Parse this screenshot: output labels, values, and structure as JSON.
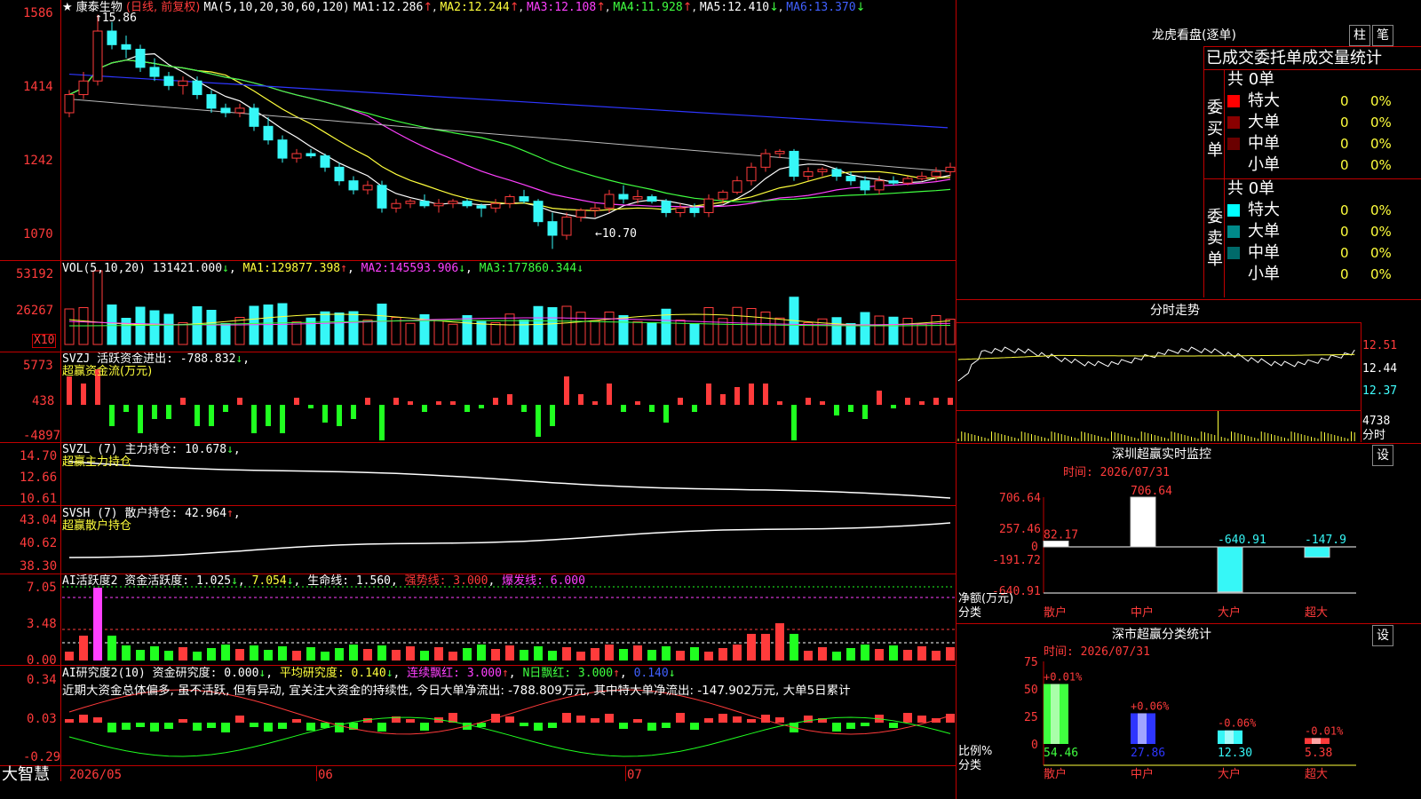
{
  "colors": {
    "up": "#ff3b3b",
    "down": "#36f7f7",
    "frame": "#c00000",
    "ma1": "#ffffff",
    "ma2": "#ffff3c",
    "ma3": "#ff40ff",
    "ma4": "#40ff40",
    "ma5": "#bbbbbb",
    "ma6": "#2e36ff"
  },
  "app": {
    "brand": "大智慧"
  },
  "main": {
    "star": "★",
    "title": "康泰生物",
    "mode": "(日线, 前复权)",
    "ma_params": "MA(5,10,20,30,60,120)",
    "ma_values": [
      {
        "label": "MA1:",
        "value": "12.286",
        "arrow": "↑"
      },
      {
        "label": "MA2:",
        "value": "12.244",
        "arrow": "↑"
      },
      {
        "label": "MA3:",
        "value": "12.108",
        "arrow": "↑"
      },
      {
        "label": "MA4:",
        "value": "11.928",
        "arrow": "↑"
      },
      {
        "label": "MA5:",
        "value": "12.410",
        "arrow": "↓"
      },
      {
        "label": "MA6:",
        "value": "13.370",
        "arrow": "↓"
      }
    ],
    "high_mark": "15.86",
    "low_mark": "10.70",
    "arrow_up": "↑",
    "arrow_left": "←",
    "y_ticks": [
      "1586",
      "1414",
      "1242",
      "1070"
    ]
  },
  "vol": {
    "title": "VOL(5,10,20)",
    "value": "131421.000",
    "value_arrow": "↓",
    "ma": [
      {
        "label": "MA1:",
        "value": "129877.398",
        "arrow": "↑"
      },
      {
        "label": "MA2:",
        "value": "145593.906",
        "arrow": "↓"
      },
      {
        "label": "MA3:",
        "value": "177860.344",
        "arrow": "↓"
      }
    ],
    "y_ticks": [
      "53192",
      "26267"
    ],
    "unit": "X10"
  },
  "svzj": {
    "line1": "SVZJ  活跃资金进出: -788.832",
    "arrow": "↓",
    "line2": "超赢资金流(万元)",
    "y_ticks": [
      "5773",
      "438",
      "-4897"
    ]
  },
  "svzl": {
    "line1": "SVZL (7) 主力持仓: 10.678",
    "arrow": "↓",
    "line2": "超赢主力持仓",
    "y_ticks": [
      "14.70",
      "12.66",
      "10.61"
    ]
  },
  "svsh": {
    "line1": "SVSH (7) 散户持仓: 42.964",
    "arrow": "↑",
    "line2": "超赢散户持仓",
    "y_ticks": [
      "43.04",
      "40.62",
      "38.30"
    ]
  },
  "ai_active": {
    "label": "AI活跃度2 资金活跃度: 1.025",
    "a1": "↓",
    "v2": "7.054",
    "a2": "↓",
    "life": "生命线: 1.560",
    "strong": "强势线: 3.000",
    "burst": "爆发线: 6.000",
    "y_ticks": [
      "7.05",
      "3.48",
      "0.00"
    ]
  },
  "ai_research": {
    "label": "AI研究度2(10) 资金研究度: 0.000",
    "a1": "↓",
    "avg": "平均研究度: 0.140",
    "a2": "↓",
    "cont": "连续飘红: 3.000",
    "a3": "↑",
    "nday": "N日飘红: 3.000",
    "a4": "↑",
    "last": "0.140",
    "a5": "↓",
    "comment": "近期大资金总体偏多, 虽不活跃, 但有异动, 宜关注大资金的持续性, 今日大单净流出: -788.809万元, 其中特大单净流出: -147.902万元, 大单5日累计",
    "y_ticks": [
      "0.34",
      "0.03",
      "-0.29"
    ]
  },
  "date_axis": [
    "2026/05",
    "06",
    "07"
  ],
  "right": {
    "lhb_title": "龙虎看盘(逐单)",
    "btn_col": "柱",
    "btn_pen": "笔",
    "tab_label": "已成交委托单成交量统计",
    "buy_side": {
      "label": "委买单",
      "total": "共 0单",
      "rows": [
        {
          "name": "特大",
          "count": "0",
          "pct": "0%",
          "color": "#ff0000"
        },
        {
          "name": "大单",
          "count": "0",
          "pct": "0%",
          "color": "#8a0000"
        },
        {
          "name": "中单",
          "count": "0",
          "pct": "0%",
          "color": "#6a0000"
        },
        {
          "name": "小单",
          "count": "0",
          "pct": "0%",
          "color": "#000000"
        }
      ]
    },
    "sell_side": {
      "label": "委卖单",
      "total": "共 0单",
      "rows": [
        {
          "name": "特大",
          "count": "0",
          "pct": "0%",
          "color": "#00ffff"
        },
        {
          "name": "大单",
          "count": "0",
          "pct": "0%",
          "color": "#008a8a"
        },
        {
          "name": "中单",
          "count": "0",
          "pct": "0%",
          "color": "#006a6a"
        },
        {
          "name": "小单",
          "count": "0",
          "pct": "0%",
          "color": "#000000"
        }
      ]
    },
    "fenshi_title": "分时走势",
    "fenshi_y": [
      "12.51",
      "12.44",
      "12.37"
    ],
    "fenshi_vol": "4738",
    "fenshi_vol_unit": "分时",
    "sz_title": "深圳超赢实时监控",
    "sz_btn": "设",
    "sz_time": "时间: 2026/07/31",
    "sz_y": [
      "706.64",
      "257.46",
      "0",
      "-191.72",
      "-640.91"
    ],
    "sz_ylabel": "净额(万元)",
    "sz_xlabel": "分类",
    "sz_cats": [
      "散户",
      "中户",
      "大户",
      "超大"
    ],
    "sz_vals": [
      "82.17",
      "706.64",
      "-640.91",
      "-147.9"
    ],
    "cls_title": "深市超赢分类统计",
    "cls_btn": "设",
    "cls_time": "时间: 2026/07/31",
    "cls_y": [
      "75",
      "50",
      "25",
      "0"
    ],
    "cls_ylabel": "比例%",
    "cls_xlabel": "分类",
    "cls_cats": [
      "散户",
      "中户",
      "大户",
      "超大"
    ],
    "cls_changes": [
      "+0.01%",
      "+0.06%",
      "-0.06%",
      "-0.01%"
    ],
    "cls_vals": [
      "54.46",
      "27.86",
      "12.30",
      "5.38"
    ]
  },
  "chart_data": [
    {
      "type": "bar",
      "title": "深圳超赢实时监控",
      "categories": [
        "散户",
        "中户",
        "大户",
        "超大"
      ],
      "values": [
        82.17,
        706.64,
        -640.91,
        -147.9
      ],
      "ylabel": "净额(万元)",
      "ylim": [
        -640.91,
        706.64
      ]
    },
    {
      "type": "bar",
      "title": "深市超赢分类统计",
      "categories": [
        "散户",
        "中户",
        "大户",
        "超大"
      ],
      "values": [
        54.46,
        27.86,
        12.3,
        5.38
      ],
      "ylabel": "比例%",
      "ylim": [
        0,
        75
      ]
    },
    {
      "type": "line",
      "title": "康泰生物",
      "ylim": [
        10.7,
        15.86
      ],
      "ohlc": [
        [
          13.7,
          14.2,
          13.6,
          14.1
        ],
        [
          14.1,
          14.6,
          14.0,
          14.4
        ],
        [
          14.4,
          15.86,
          14.3,
          15.5
        ],
        [
          15.5,
          15.7,
          15.1,
          15.2
        ],
        [
          15.2,
          15.4,
          14.9,
          15.1
        ],
        [
          15.1,
          15.2,
          14.6,
          14.7
        ],
        [
          14.7,
          14.9,
          14.4,
          14.5
        ],
        [
          14.5,
          14.6,
          14.2,
          14.3
        ],
        [
          14.3,
          14.5,
          14.1,
          14.4
        ],
        [
          14.4,
          14.5,
          14.0,
          14.1
        ],
        [
          14.1,
          14.2,
          13.7,
          13.8
        ],
        [
          13.8,
          13.9,
          13.6,
          13.7
        ],
        [
          13.7,
          13.9,
          13.6,
          13.8
        ],
        [
          13.8,
          13.9,
          13.3,
          13.4
        ],
        [
          13.4,
          13.6,
          13.0,
          13.1
        ],
        [
          13.1,
          13.2,
          12.6,
          12.7
        ],
        [
          12.7,
          12.9,
          12.6,
          12.8
        ],
        [
          12.8,
          12.9,
          12.7,
          12.75
        ],
        [
          12.75,
          12.8,
          12.4,
          12.5
        ],
        [
          12.5,
          12.6,
          12.1,
          12.2
        ],
        [
          12.2,
          12.3,
          11.9,
          12.0
        ],
        [
          12.0,
          12.2,
          11.9,
          12.1
        ],
        [
          12.1,
          12.2,
          11.5,
          11.6
        ],
        [
          11.6,
          11.8,
          11.5,
          11.7
        ],
        [
          11.7,
          11.8,
          11.6,
          11.75
        ],
        [
          11.75,
          11.9,
          11.6,
          11.65
        ],
        [
          11.65,
          11.8,
          11.5,
          11.7
        ],
        [
          11.7,
          11.8,
          11.6,
          11.75
        ],
        [
          11.75,
          11.8,
          11.6,
          11.65
        ],
        [
          11.65,
          11.7,
          11.4,
          11.6
        ],
        [
          11.6,
          11.8,
          11.5,
          11.7
        ],
        [
          11.7,
          11.9,
          11.6,
          11.85
        ],
        [
          11.85,
          12.0,
          11.7,
          11.75
        ],
        [
          11.75,
          11.8,
          11.2,
          11.3
        ],
        [
          11.3,
          11.5,
          10.7,
          11.0
        ],
        [
          11.0,
          11.5,
          10.9,
          11.4
        ],
        [
          11.4,
          11.6,
          11.3,
          11.55
        ],
        [
          11.55,
          11.7,
          11.4,
          11.6
        ],
        [
          11.6,
          12.0,
          11.5,
          11.9
        ],
        [
          11.9,
          12.1,
          11.7,
          11.8
        ],
        [
          11.8,
          12.0,
          11.7,
          11.85
        ],
        [
          11.85,
          11.9,
          11.7,
          11.75
        ],
        [
          11.75,
          11.8,
          11.4,
          11.5
        ],
        [
          11.5,
          11.7,
          11.4,
          11.6
        ],
        [
          11.6,
          11.7,
          11.4,
          11.5
        ],
        [
          11.5,
          11.9,
          11.4,
          11.8
        ],
        [
          11.8,
          12.0,
          11.7,
          11.95
        ],
        [
          11.95,
          12.3,
          11.9,
          12.2
        ],
        [
          12.2,
          12.6,
          12.1,
          12.5
        ],
        [
          12.5,
          12.9,
          12.4,
          12.8
        ],
        [
          12.8,
          12.9,
          12.7,
          12.85
        ],
        [
          12.85,
          12.9,
          12.2,
          12.3
        ],
        [
          12.3,
          12.5,
          12.2,
          12.4
        ],
        [
          12.4,
          12.5,
          12.3,
          12.45
        ],
        [
          12.45,
          12.5,
          12.2,
          12.3
        ],
        [
          12.3,
          12.4,
          12.1,
          12.2
        ],
        [
          12.2,
          12.3,
          11.9,
          12.0
        ],
        [
          12.0,
          12.3,
          11.9,
          12.2
        ],
        [
          12.2,
          12.3,
          12.1,
          12.15
        ],
        [
          12.15,
          12.3,
          12.1,
          12.25
        ],
        [
          12.25,
          12.4,
          12.2,
          12.3
        ],
        [
          12.3,
          12.5,
          12.2,
          12.4
        ],
        [
          12.4,
          12.6,
          12.3,
          12.5
        ]
      ]
    }
  ]
}
